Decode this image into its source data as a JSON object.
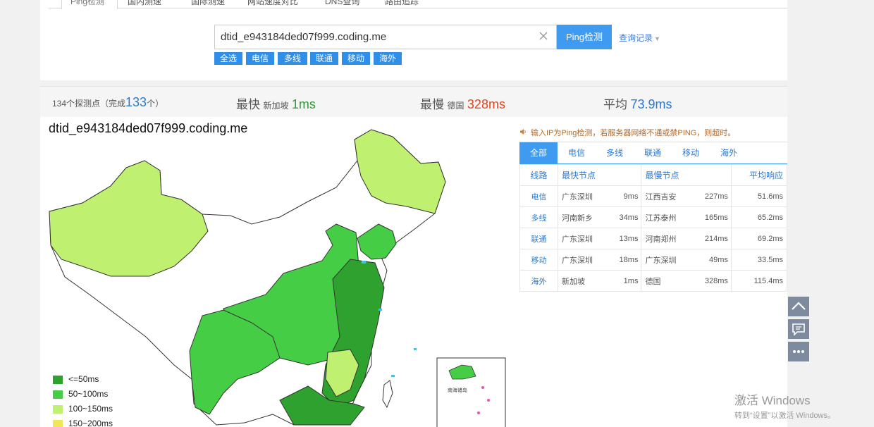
{
  "top_tabs": [
    "Ping检测",
    "国内测速",
    "国际测速",
    "网站速度对比",
    "DNS查询",
    "路由追踪"
  ],
  "search": {
    "value": "dtid_e943184ded07f999.coding.me",
    "button": "Ping检测",
    "history": "查询记录"
  },
  "filters": [
    "全选",
    "电信",
    "多线",
    "联通",
    "移动",
    "海外"
  ],
  "stats": {
    "nodes_prefix": "134个探测点（完成",
    "nodes_done": "133",
    "nodes_suffix": "个）",
    "fastest_label": "最快",
    "fastest_location": "新加坡",
    "fastest_value": "1ms",
    "slowest_label": "最慢",
    "slowest_location": "德国",
    "slowest_value": "328ms",
    "avg_label": "平均",
    "avg_value": "73.9ms"
  },
  "map": {
    "title": "dtid_e943184ded07f999.coding.me",
    "legend": [
      {
        "label": "<=50ms",
        "color": "#2ea12e"
      },
      {
        "label": "50~100ms",
        "color": "#46cd46"
      },
      {
        "label": "100~150ms",
        "color": "#c0f070"
      },
      {
        "label": "150~200ms",
        "color": "#f0e65a"
      }
    ],
    "inset_labels": [
      "南海诸岛"
    ]
  },
  "notice": "输入IP为Ping检测，若服务器网络不通或禁PING，则超时。",
  "net_tabs": [
    "全部",
    "电信",
    "多线",
    "联通",
    "移动",
    "海外"
  ],
  "table": {
    "headers": [
      "线路",
      "最快节点",
      "最慢节点",
      "平均响应"
    ],
    "rows": [
      {
        "line": "电信",
        "fast_node": "广东深圳",
        "fast_ms": "9ms",
        "slow_node": "江西吉安",
        "slow_ms": "227ms",
        "avg": "51.6ms"
      },
      {
        "line": "多线",
        "fast_node": "河南新乡",
        "fast_ms": "34ms",
        "slow_node": "江苏泰州",
        "slow_ms": "165ms",
        "avg": "65.2ms"
      },
      {
        "line": "联通",
        "fast_node": "广东深圳",
        "fast_ms": "13ms",
        "slow_node": "河南郑州",
        "slow_ms": "214ms",
        "avg": "69.2ms"
      },
      {
        "line": "移动",
        "fast_node": "广东深圳",
        "fast_ms": "18ms",
        "slow_node": "广东深圳",
        "slow_ms": "49ms",
        "avg": "33.5ms"
      },
      {
        "line": "海外",
        "fast_node": "新加坡",
        "fast_ms": "1ms",
        "slow_node": "德国",
        "slow_ms": "328ms",
        "avg": "115.4ms"
      }
    ]
  },
  "watermark": {
    "title": "激活 Windows",
    "subtitle": "转到“设置”以激活 Windows。"
  }
}
